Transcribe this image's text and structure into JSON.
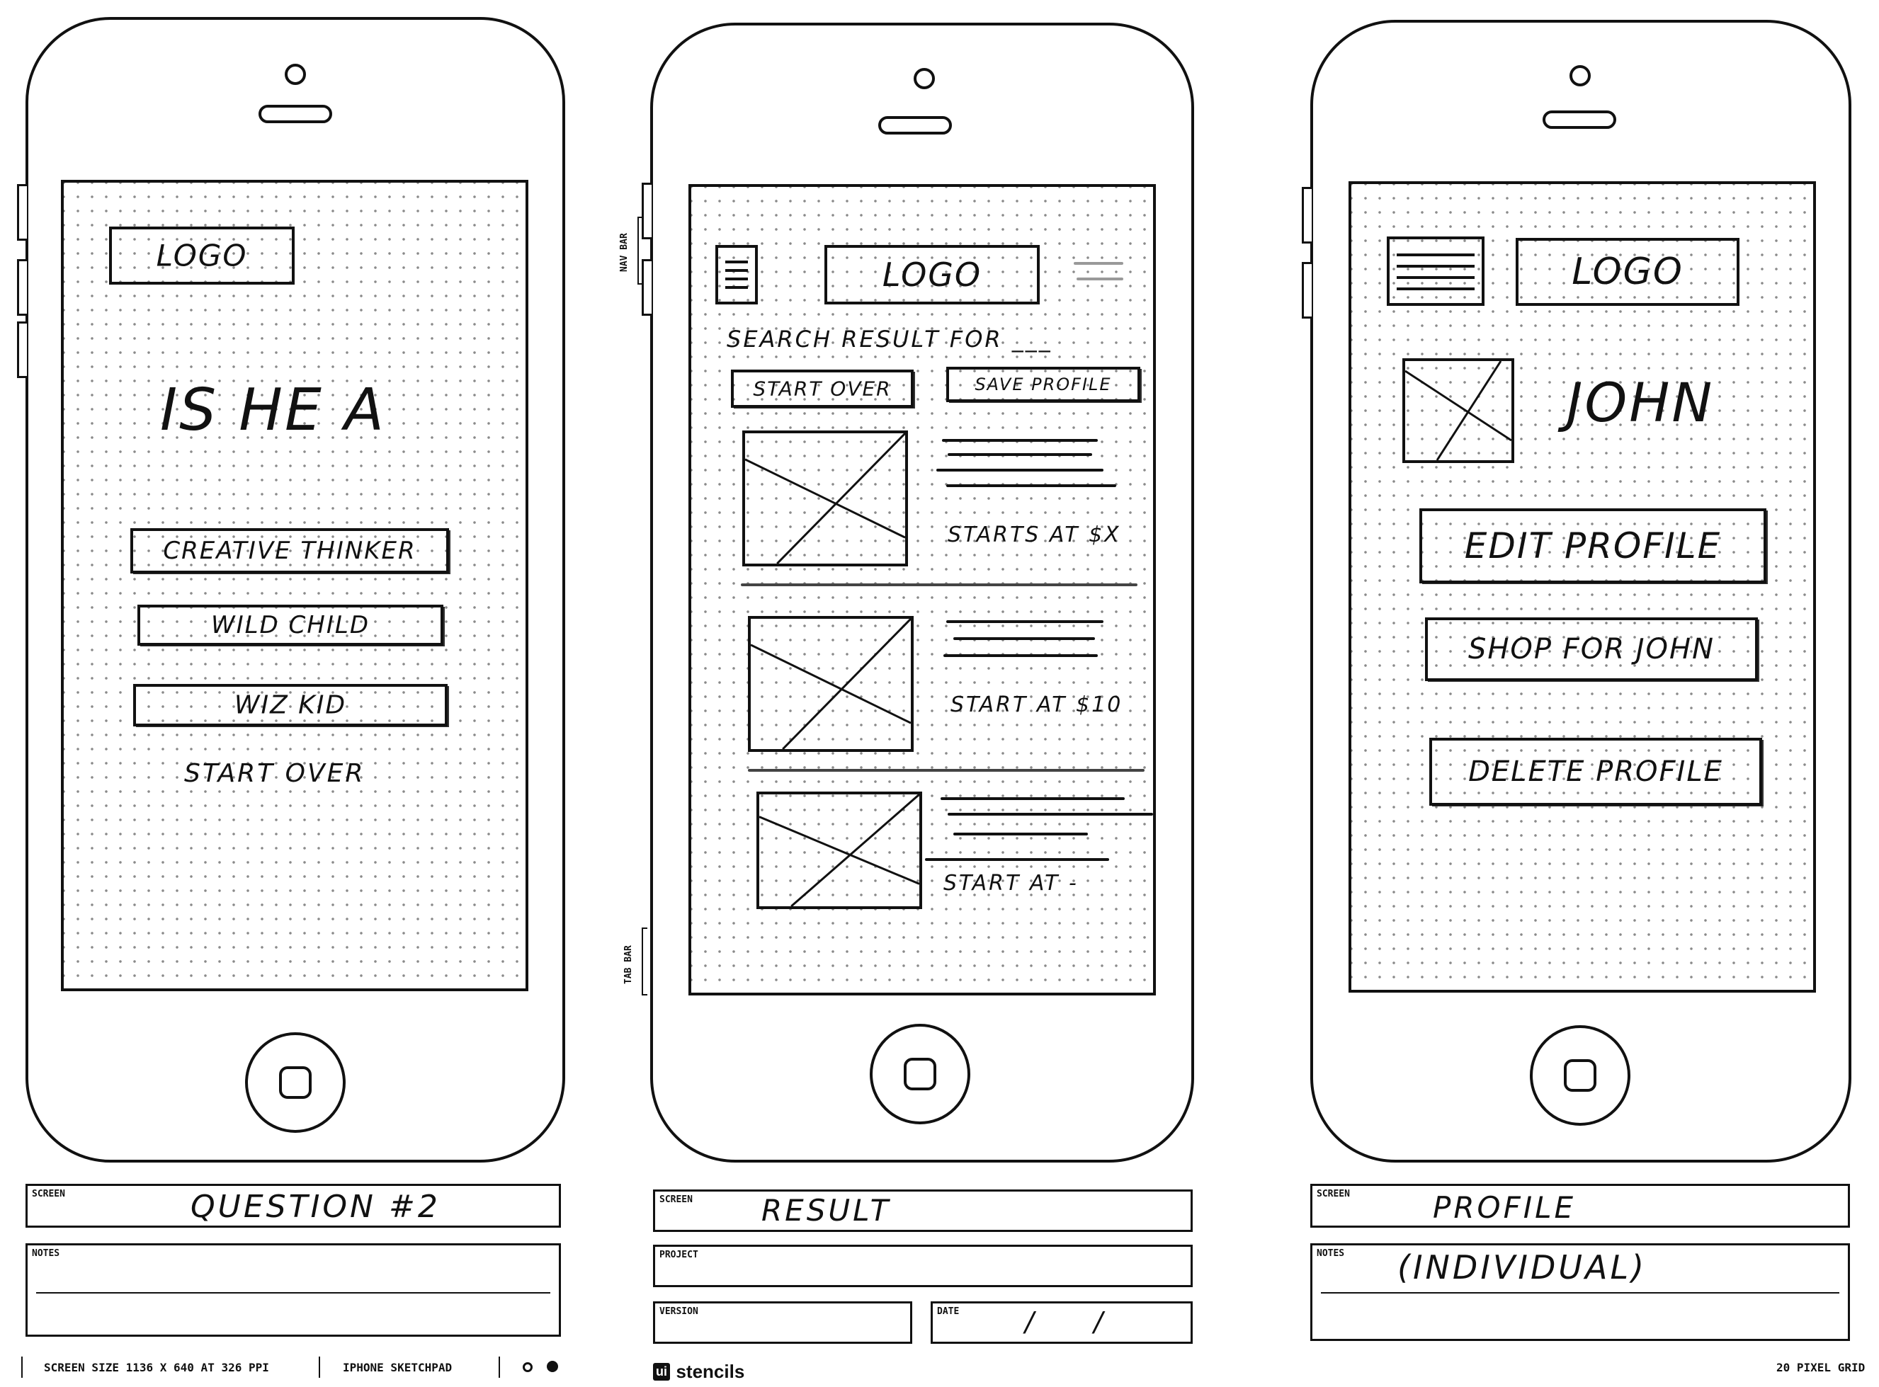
{
  "phones": [
    {
      "logo": "LOGO",
      "heading": "IS HE A",
      "options": [
        "CREATIVE THINKER",
        "WILD CHILD",
        "WIZ KID"
      ],
      "start_over": "START OVER",
      "screen_label": "SCREEN",
      "screen_value": "QUESTION #2",
      "notes_label": "NOTES",
      "notes_value": ""
    },
    {
      "nav_bar_label": "NAV BAR",
      "tab_bar_label": "TAB BAR",
      "menu_icon": "hamburger-menu-icon",
      "logo": "LOGO",
      "search_text": "SEARCH RESULT FOR ___",
      "buttons": [
        "START OVER",
        "SAVE PROFILE"
      ],
      "results": [
        {
          "price": "STARTS AT $X"
        },
        {
          "price": "START AT $10"
        },
        {
          "price": "START AT -"
        }
      ],
      "screen_label": "SCREEN",
      "screen_value": "RESULT",
      "project_label": "PROJECT",
      "version_label": "VERSION",
      "date_label": "DATE",
      "date_value": "/     /"
    },
    {
      "menu_icon": "hamburger-menu-icon",
      "logo": "LOGO",
      "name": "JOHN",
      "buttons": [
        "EDIT PROFILE",
        "SHOP FOR JOHN",
        "DELETE PROFILE"
      ],
      "screen_label": "SCREEN",
      "screen_value": "PROFILE",
      "notes_label": "NOTES",
      "notes_value": "(INDIVIDUAL)"
    }
  ],
  "footer": {
    "screen_size": "SCREEN SIZE 1136 X 640 AT 326 PPI",
    "sketchpad": "IPHONE SKETCHPAD",
    "brand_badge": "ui",
    "brand": "stencils",
    "grid": "20 PIXEL GRID"
  }
}
